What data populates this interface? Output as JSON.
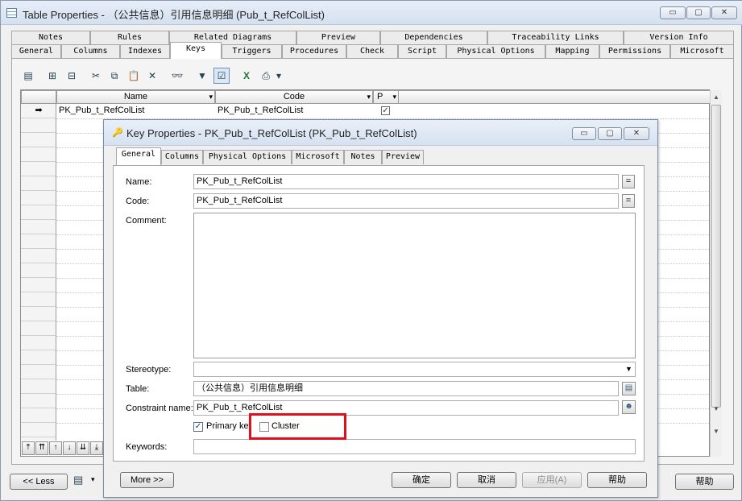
{
  "window": {
    "title": "Table Properties - （公共信息）引用信息明细 (Pub_t_RefColList)",
    "min_glyph": "▭",
    "max_glyph": "▢",
    "close_glyph": "✕"
  },
  "tabs_row1": [
    "Notes",
    "Rules",
    "Related Diagrams",
    "Preview",
    "Dependencies",
    "Traceability Links",
    "Version Info"
  ],
  "tabs_row2": [
    "General",
    "Columns",
    "Indexes",
    "Keys",
    "Triggers",
    "Procedures",
    "Check",
    "Script",
    "Physical Options",
    "Mapping",
    "Permissions",
    "Microsoft"
  ],
  "active_tab": "Keys",
  "toolbar": {
    "properties": "▤",
    "insert_row": "⊞",
    "add_row": "⊟",
    "cut": "✂",
    "copy": "⧉",
    "paste": "📋",
    "delete": "✕",
    "find": "👓",
    "filter": "▼",
    "customize_columns": "☑",
    "excel": "X",
    "print": "⎙",
    "print_dropdown": "▾"
  },
  "keys_grid": {
    "columns": [
      "Name",
      "Code",
      "P"
    ],
    "rows": [
      {
        "marker": "➡",
        "name": "PK_Pub_t_RefColList",
        "code": "PK_Pub_t_RefColList",
        "primary": "✓"
      }
    ],
    "nav_buttons": [
      "⤒",
      "⇈",
      "↑",
      "↓",
      "⇊",
      "⤓"
    ],
    "dropdown_glyph": "▾"
  },
  "dialog": {
    "title": "Key Properties - PK_Pub_t_RefColList (PK_Pub_t_RefColList)",
    "title_icon": "🔑",
    "tabs": [
      "General",
      "Columns",
      "Physical Options",
      "Microsoft",
      "Notes",
      "Preview"
    ],
    "active_tab": "General",
    "fields": {
      "name_label": "Name:",
      "name_value": "PK_Pub_t_RefColList",
      "code_label": "Code:",
      "code_value": "PK_Pub_t_RefColList",
      "comment_label": "Comment:",
      "comment_value": "",
      "stereotype_label": "Stereotype:",
      "stereotype_value": "",
      "table_label": "Table:",
      "table_value": "（公共信息）引用信息明细",
      "constraint_label": "Constraint name:",
      "constraint_value": "PK_Pub_t_RefColList",
      "primary_key_label": "Primary key",
      "primary_key_checked": "✓",
      "cluster_label": "Cluster",
      "keywords_label": "Keywords:",
      "keywords_value": "",
      "equals_glyph": "="
    },
    "buttons": {
      "more": "More >>",
      "ok": "确定",
      "cancel": "取消",
      "apply": "应用(A)",
      "help": "帮助"
    }
  },
  "bottom": {
    "less": "<< Less",
    "help": "帮助"
  },
  "colors": {
    "highlight": "#e0101b",
    "title_bar": "#d5e1f0",
    "accent_border": "#7a8ea8"
  }
}
